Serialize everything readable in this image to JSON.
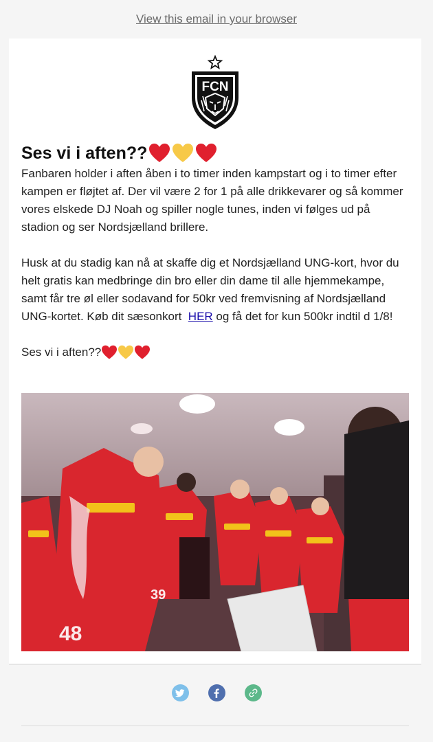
{
  "header": {
    "view_in_browser": "View this email in your browser"
  },
  "content": {
    "heading": "Ses vi i aften??",
    "paragraph1": "Fanbaren holder i aften åben i to timer inden kampstart og i to timer efter kampen er fløjtet af. Der vil være 2 for 1 på alle drikkevarer og så kommer vores elskede DJ Noah og spiller nogle tunes, inden vi følges ud på stadion og ser Nordsjælland brillere.",
    "paragraph2_before_link": "Husk at du stadig kan nå at skaffe dig et Nordsjælland UNG-kort, hvor du helt gratis kan medbringe din bro eller din dame til alle hjemmekampe, samt får tre øl eller sodavand for 50kr ved fremvisning af Nordsjælland UNG-kortet. Køb dit sæsonkort  ",
    "link_label": "HER",
    "paragraph2_after_link": " og få det for kun 500kr indtil d 1/8!",
    "closing": "Ses vi i aften??"
  },
  "logo": {
    "letters": "FCN"
  },
  "colors": {
    "heart_red": "#e0202e",
    "heart_yellow": "#f7c948",
    "twitter": "#7fc0ea",
    "facebook": "#4f6fae",
    "link": "#5cb88a"
  },
  "icons": [
    "heart-red-icon",
    "heart-yellow-icon",
    "twitter-icon",
    "facebook-icon",
    "link-icon"
  ]
}
